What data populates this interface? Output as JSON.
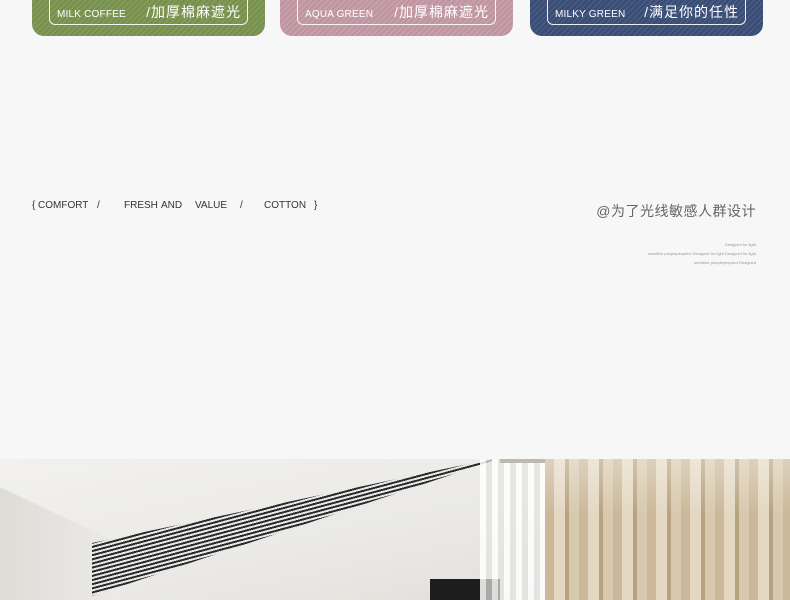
{
  "swatches": [
    {
      "en": "MILK COFFEE",
      "cn": "/加厚棉麻遮光",
      "color": "#7b9550"
    },
    {
      "en": "AQUA GREEN",
      "cn": "/加厚棉麻遮光",
      "color": "#c49aa6"
    },
    {
      "en": "MILKY GREEN",
      "cn": "/满足你的任性",
      "color": "#3b4f78"
    }
  ],
  "tagline": {
    "open": "{",
    "comfort": "COMFORT",
    "slash1": "/",
    "fresh": "FRESH",
    "and": "AND",
    "value": "VALUE",
    "slash2": "/",
    "cotton": "COTTON",
    "close": "}"
  },
  "slogan": "@为了光线敏感人群设计",
  "fine_print": [
    "Designed for light",
    "sensitive peoplepeoplect Designed for light Designed for light",
    "sensitive peoplepeoplect Designed"
  ]
}
